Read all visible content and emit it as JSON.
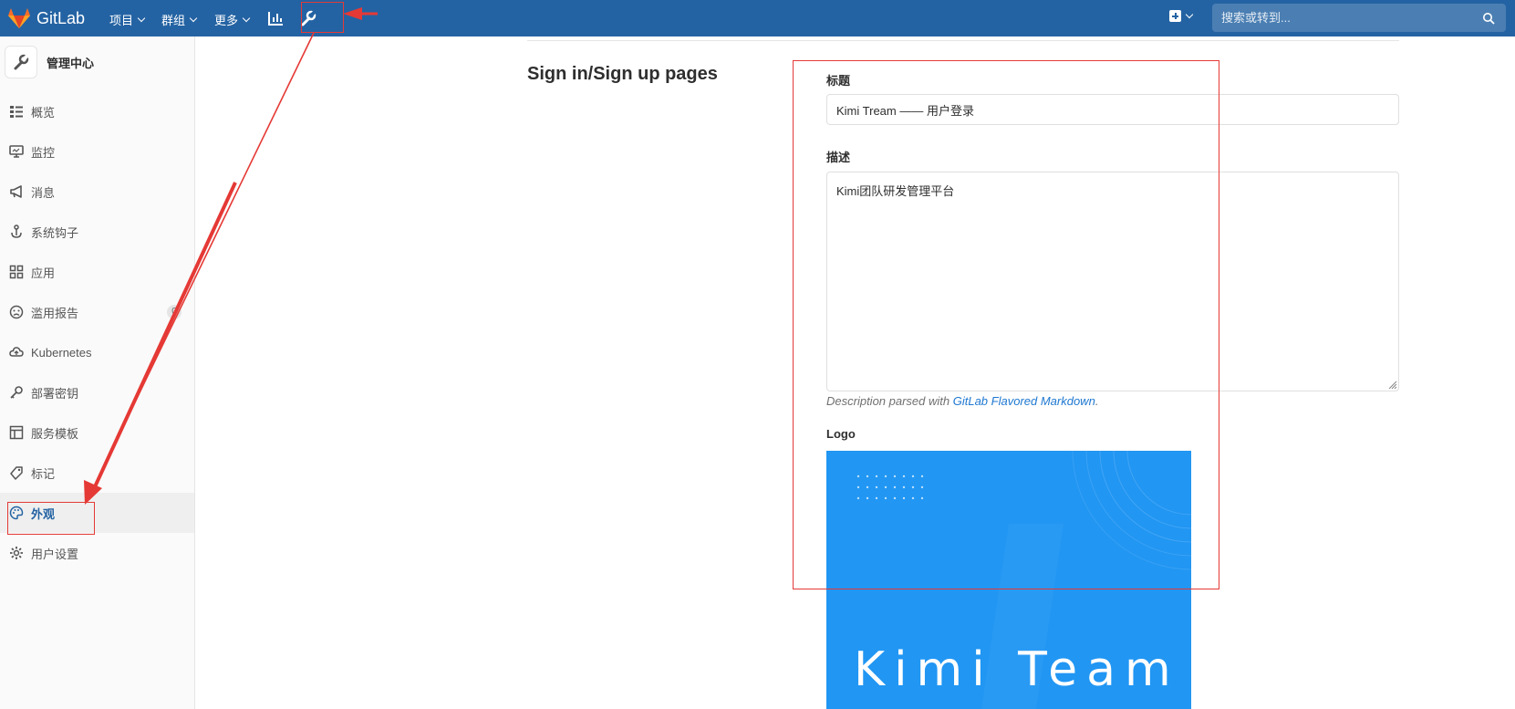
{
  "navbar": {
    "brand": "GitLab",
    "items": [
      {
        "label": "项目"
      },
      {
        "label": "群组"
      },
      {
        "label": "更多"
      }
    ],
    "search_placeholder": "搜索或转到..."
  },
  "sidebar": {
    "title": "管理中心",
    "items": [
      {
        "label": "概览",
        "icon": "overview-icon"
      },
      {
        "label": "监控",
        "icon": "monitor-icon"
      },
      {
        "label": "消息",
        "icon": "megaphone-icon"
      },
      {
        "label": "系统钩子",
        "icon": "hook-icon"
      },
      {
        "label": "应用",
        "icon": "apps-icon"
      },
      {
        "label": "滥用报告",
        "icon": "sad-face-icon",
        "count": "0"
      },
      {
        "label": "Kubernetes",
        "icon": "cloud-icon"
      },
      {
        "label": "部署密钥",
        "icon": "key-icon"
      },
      {
        "label": "服务模板",
        "icon": "template-icon"
      },
      {
        "label": "标记",
        "icon": "label-icon"
      },
      {
        "label": "外观",
        "icon": "palette-icon",
        "active": true
      },
      {
        "label": "用户设置",
        "icon": "gear-icon"
      }
    ]
  },
  "main": {
    "section_title": "Sign in/Sign up pages",
    "title_label": "标题",
    "title_value": "Kimi Tream ——  用户登录",
    "description_label": "描述",
    "description_value": "Kimi团队研发管理平台",
    "help_prefix": "Description parsed with ",
    "help_link": "GitLab Flavored Markdown",
    "help_suffix": ".",
    "logo_label": "Logo",
    "logo_text": "Kimi Team"
  },
  "colors": {
    "navbar": "#2463a3",
    "logo_bg": "#2196f3",
    "annotation": "#e53935"
  }
}
